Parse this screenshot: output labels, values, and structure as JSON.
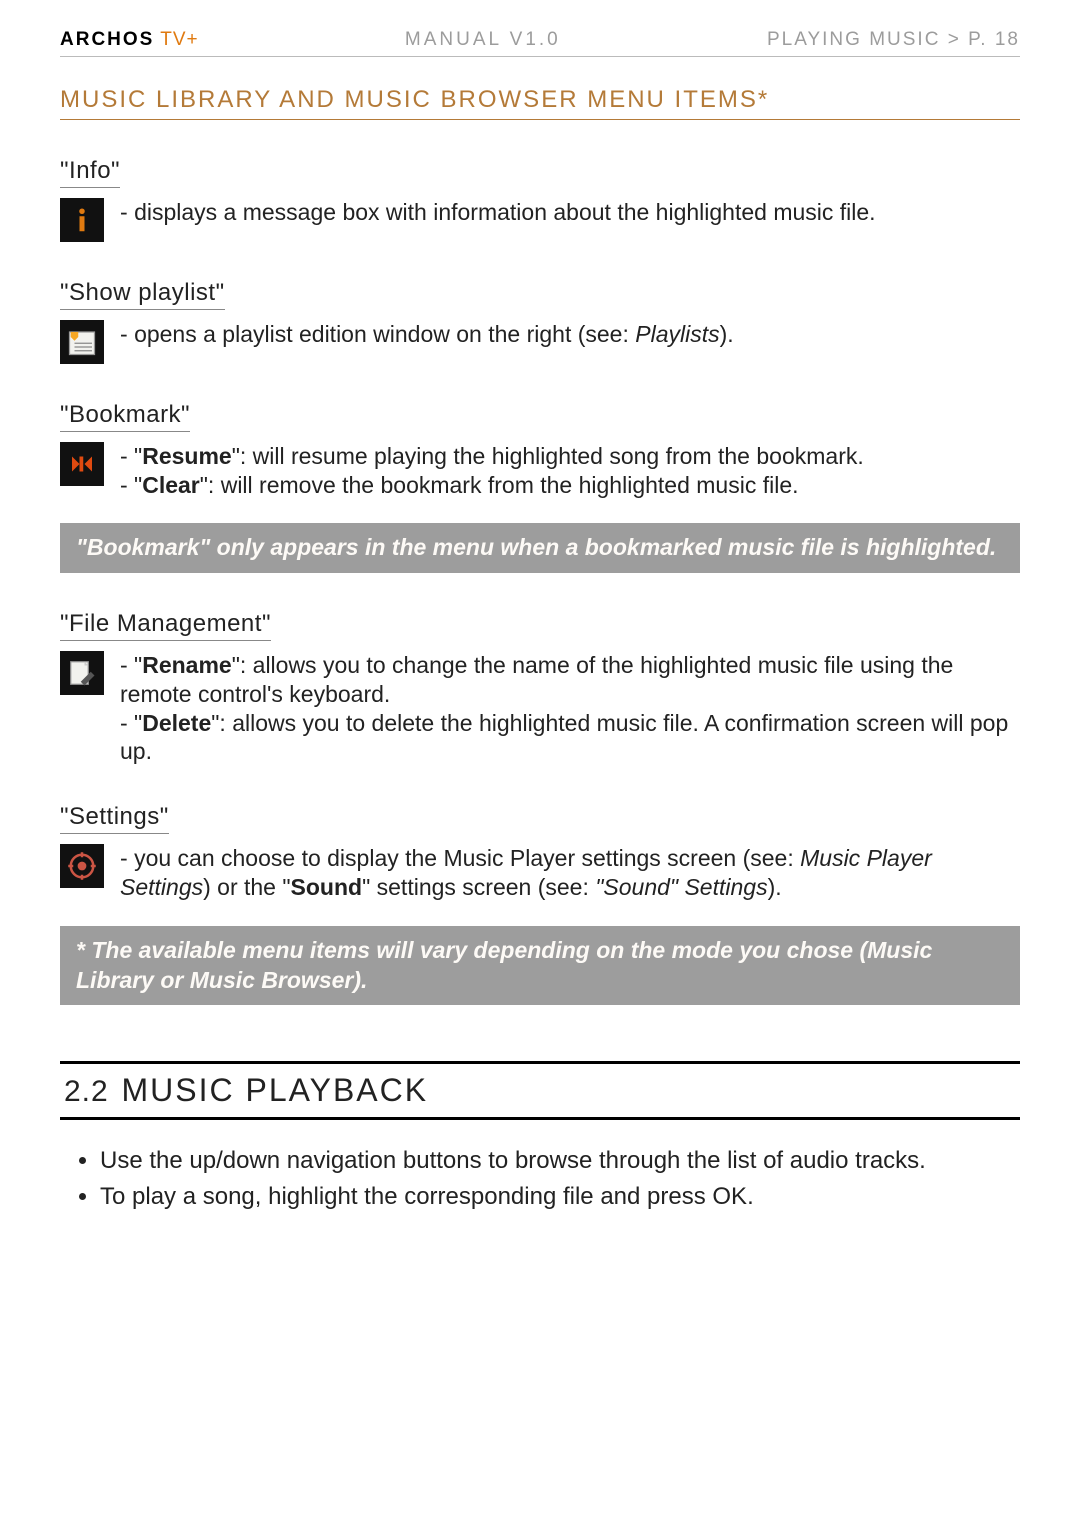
{
  "brand": {
    "main": "ARCHOS",
    "accent": " TV+"
  },
  "manual_version": "MANUAL V1.0",
  "right_header": "PLAYING MUSIC   >   P. 18",
  "section_title": "MUSIC LIBRARY AND MUSIC BROWSER MENU ITEMS*",
  "info": {
    "name": "\"Info\"",
    "desc": "displays a message box with information about the highlighted music file."
  },
  "show_playlist": {
    "name": "\"Show playlist\"",
    "desc_pre": "opens a playlist edition window on the right (see: ",
    "link": "Playlists",
    "desc_post": ")."
  },
  "bookmark": {
    "name": "\"Bookmark\"",
    "resume_lbl": "Resume",
    "resume_txt": "\": will resume playing the highlighted song from the bookmark.",
    "clear_lbl": "Clear",
    "clear_txt": "\": will remove the bookmark from the highlighted music file."
  },
  "bookmark_note": "\"Bookmark\" only appears in the menu when a bookmarked music file is highlighted.",
  "file_mgmt": {
    "name": "\"File Management\"",
    "rename_lbl": "Rename",
    "rename_txt": "\": allows you to change the name of the highlighted music file using the remote control's keyboard.",
    "delete_lbl": "Delete",
    "delete_txt": "\": allows you to delete the highlighted music file. A confirmation screen will pop up."
  },
  "settings": {
    "name": "\"Settings\"",
    "pre": "you can choose to display the Music Player settings screen (see: ",
    "link1": "Music Player Settings",
    "mid": ") or the \"",
    "sound_bold": "Sound",
    "mid2": "\" settings screen (see: ",
    "link2": "\"Sound\" Settings",
    "post": ")."
  },
  "footnote": "* The available menu items will vary depending on the mode you chose (Music Library or Music Browser).",
  "playback": {
    "num": "2.2",
    "title": "MUSIC PLAYBACK",
    "b1": "Use the up/down navigation buttons to browse through the list of audio tracks.",
    "b2_pre": "To play a song, highlight the corresponding file and press ",
    "b2_ok": "OK",
    "b2_post": "."
  }
}
